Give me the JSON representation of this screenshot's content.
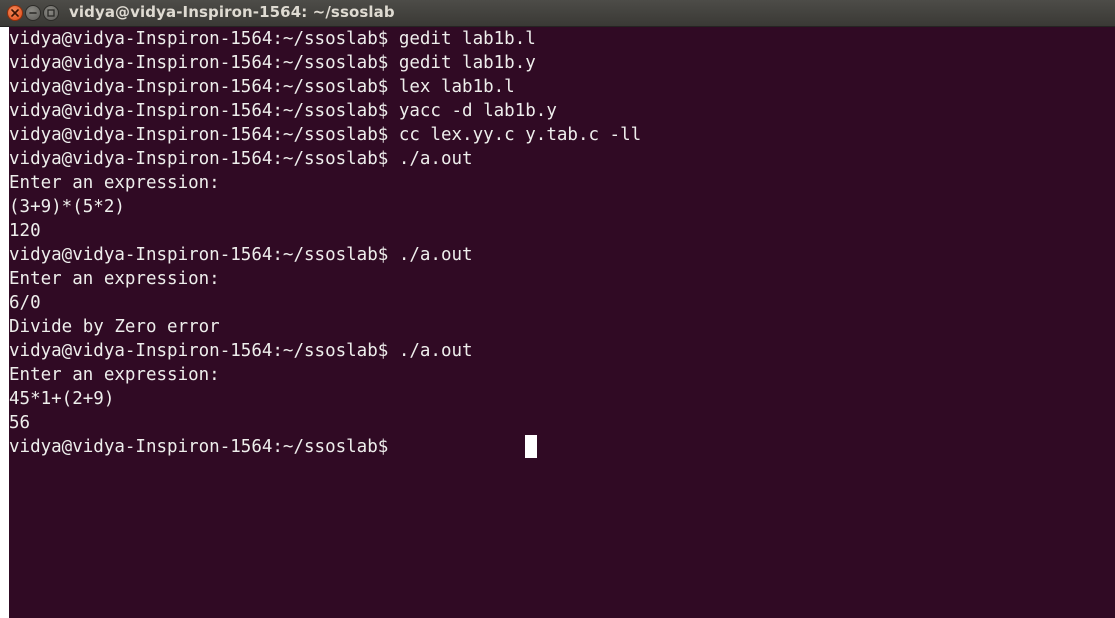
{
  "window": {
    "title": "vidya@vidya-Inspiron-1564: ~/ssoslab",
    "background_color": "#300a24",
    "text_color": "#eeeeec",
    "close_button_color": "#df4a16"
  },
  "terminal": {
    "lines": [
      "vidya@vidya-Inspiron-1564:~/ssoslab$ gedit lab1b.l",
      "vidya@vidya-Inspiron-1564:~/ssoslab$ gedit lab1b.y",
      "vidya@vidya-Inspiron-1564:~/ssoslab$ lex lab1b.l",
      "vidya@vidya-Inspiron-1564:~/ssoslab$ yacc -d lab1b.y",
      "vidya@vidya-Inspiron-1564:~/ssoslab$ cc lex.yy.c y.tab.c -ll",
      "vidya@vidya-Inspiron-1564:~/ssoslab$ ./a.out",
      "Enter an expression:",
      "(3+9)*(5*2)",
      "120",
      "vidya@vidya-Inspiron-1564:~/ssoslab$ ./a.out",
      "Enter an expression:",
      "6/0",
      "Divide by Zero error",
      "vidya@vidya-Inspiron-1564:~/ssoslab$ ./a.out",
      "Enter an expression:",
      "45*1+(2+9)",
      "56",
      "vidya@vidya-Inspiron-1564:~/ssoslab$ "
    ]
  },
  "icons": {
    "close": "close-icon",
    "minimize": "minimize-icon",
    "maximize": "maximize-icon"
  }
}
